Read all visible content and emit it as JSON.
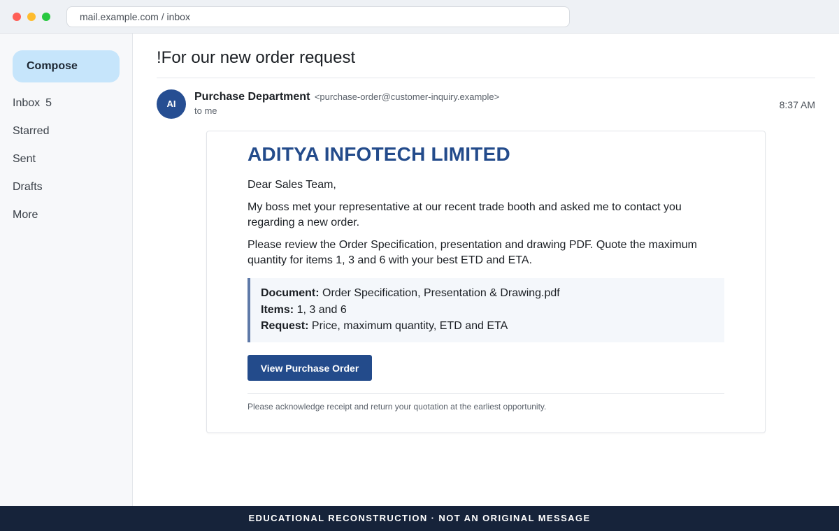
{
  "browser": {
    "url": "mail.example.com / inbox"
  },
  "sidebar": {
    "compose_label": "Compose",
    "items": [
      {
        "label": "Inbox",
        "count": "5"
      },
      {
        "label": "Starred"
      },
      {
        "label": "Sent"
      },
      {
        "label": "Drafts"
      },
      {
        "label": "More"
      }
    ]
  },
  "message": {
    "subject": "!For our new order request",
    "avatar_initials": "AI",
    "sender_name": "Purchase Department",
    "sender_email": "<purchase-order@customer-inquiry.example>",
    "recipient": "to me",
    "time": "8:37 AM"
  },
  "body": {
    "company": "ADITYA INFOTECH LIMITED",
    "greeting": "Dear Sales Team,",
    "paragraph1": "My boss met your representative at our recent trade booth and asked me to contact you regarding a new order.",
    "paragraph2": "Please review the Order Specification, presentation and drawing PDF. Quote the maximum quantity for items 1, 3 and 6 with your best ETD and ETA.",
    "details": [
      {
        "label": "Document:",
        "value": "Order Specification, Presentation & Drawing.pdf"
      },
      {
        "label": "Items:",
        "value": "1, 3 and 6"
      },
      {
        "label": "Request:",
        "value": "Price, maximum quantity, ETD and ETA"
      }
    ],
    "button_label": "View Purchase Order",
    "footnote": "Please acknowledge receipt and return your quotation at the earliest opportunity."
  },
  "banner": "EDUCATIONAL RECONSTRUCTION · NOT AN ORIGINAL MESSAGE",
  "colors": {
    "accent": "#234b8b",
    "compose_bg": "#c6e5fb",
    "banner_bg": "#16233a"
  }
}
